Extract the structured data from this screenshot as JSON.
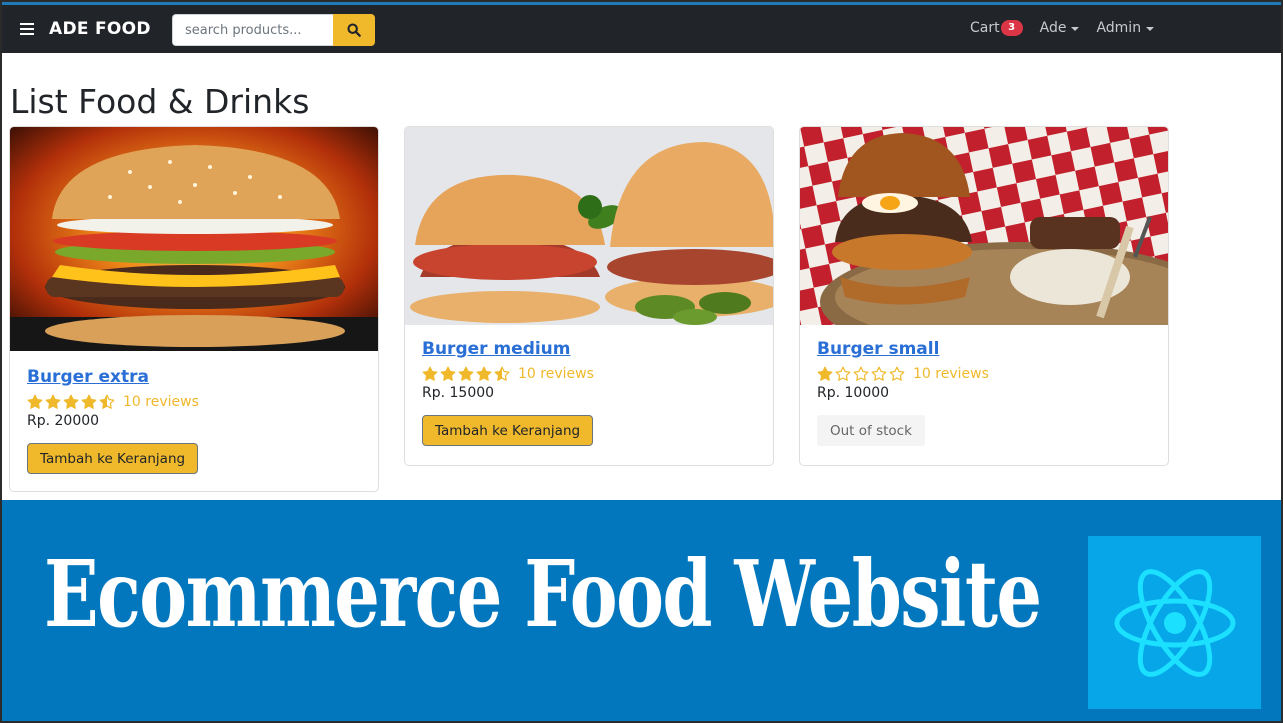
{
  "navbar": {
    "brand": "ADE FOOD",
    "search_placeholder": "search products...",
    "cart_label": "Cart",
    "cart_count": "3",
    "user_menu": "Ade",
    "admin_menu": "Admin"
  },
  "page": {
    "title": "List Food & Drinks"
  },
  "products": [
    {
      "name": "Burger extra",
      "rating": 4.5,
      "reviews": "10 reviews",
      "price": "Rp. 20000",
      "action": "Tambah ke Keranjang",
      "in_stock": true
    },
    {
      "name": "Burger medium",
      "rating": 4.5,
      "reviews": "10 reviews",
      "price": "Rp. 15000",
      "action": "Tambah ke Keranjang",
      "in_stock": true
    },
    {
      "name": "Burger small",
      "rating": 1,
      "reviews": "10 reviews",
      "price": "Rp. 10000",
      "action": "Out of stock",
      "in_stock": false
    }
  ],
  "banner": {
    "title": "Ecommerce Food Website",
    "logo_icon": "react-logo-icon"
  },
  "colors": {
    "navbar_bg": "#212529",
    "accent_yellow": "#f0b92c",
    "link_blue": "#2a6fd6",
    "badge_red": "#dc3545",
    "banner_blue": "#0277bd",
    "react_box": "#06a6e8"
  }
}
